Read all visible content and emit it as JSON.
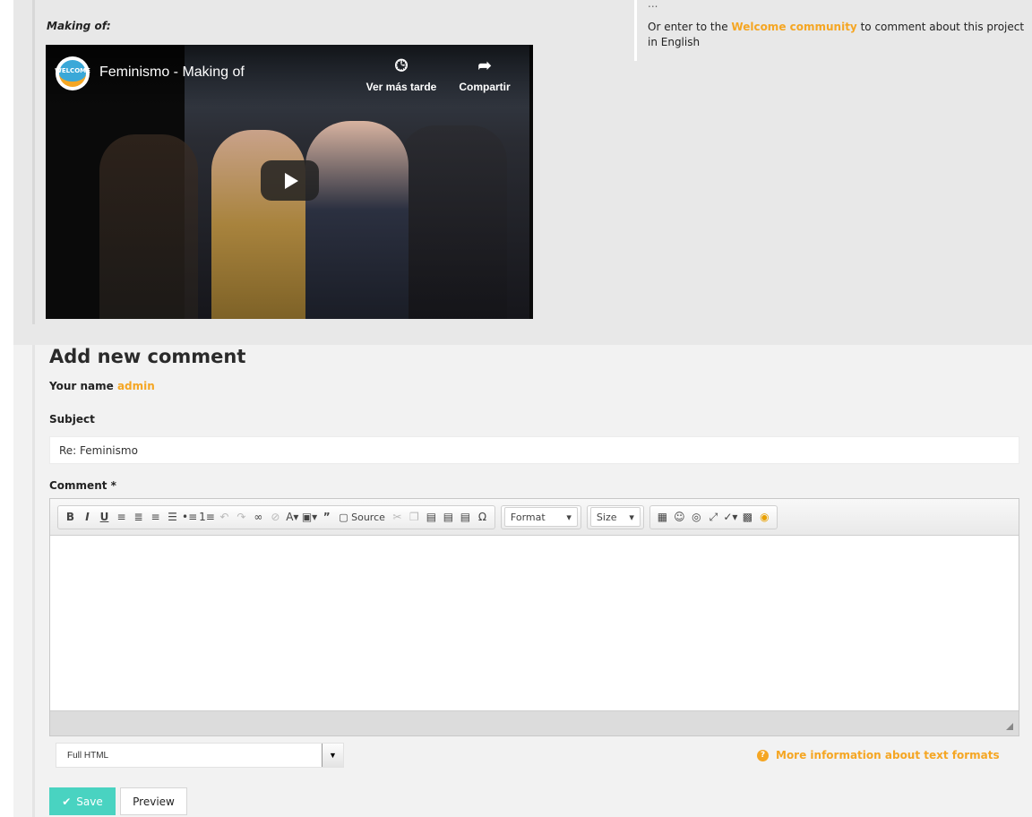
{
  "making_of": {
    "label": "Making of:",
    "video": {
      "channel_logo_text": "WELCOME",
      "title": "Feminismo - Making of",
      "watch_later_label": "Ver más tarde",
      "share_label": "Compartir"
    }
  },
  "side_note": {
    "partial_text": "...",
    "prefix": "Or enter to the ",
    "link_text": "Welcome community",
    "suffix": " to comment about this project in English"
  },
  "comment_form": {
    "title": "Add new comment",
    "your_name_label": "Your name",
    "your_name_value": "admin",
    "subject_label": "Subject",
    "subject_value": "Re: Feminismo",
    "comment_label": "Comment *",
    "toolbar": {
      "source_label": "Source",
      "format_label": "Format",
      "size_label": "Size"
    },
    "text_format_selected": "Full HTML",
    "more_info_label": "More information about text formats",
    "save_label": "Save",
    "preview_label": "Preview"
  },
  "colors": {
    "accent": "#f5a623",
    "save_button": "#49d3c1"
  }
}
